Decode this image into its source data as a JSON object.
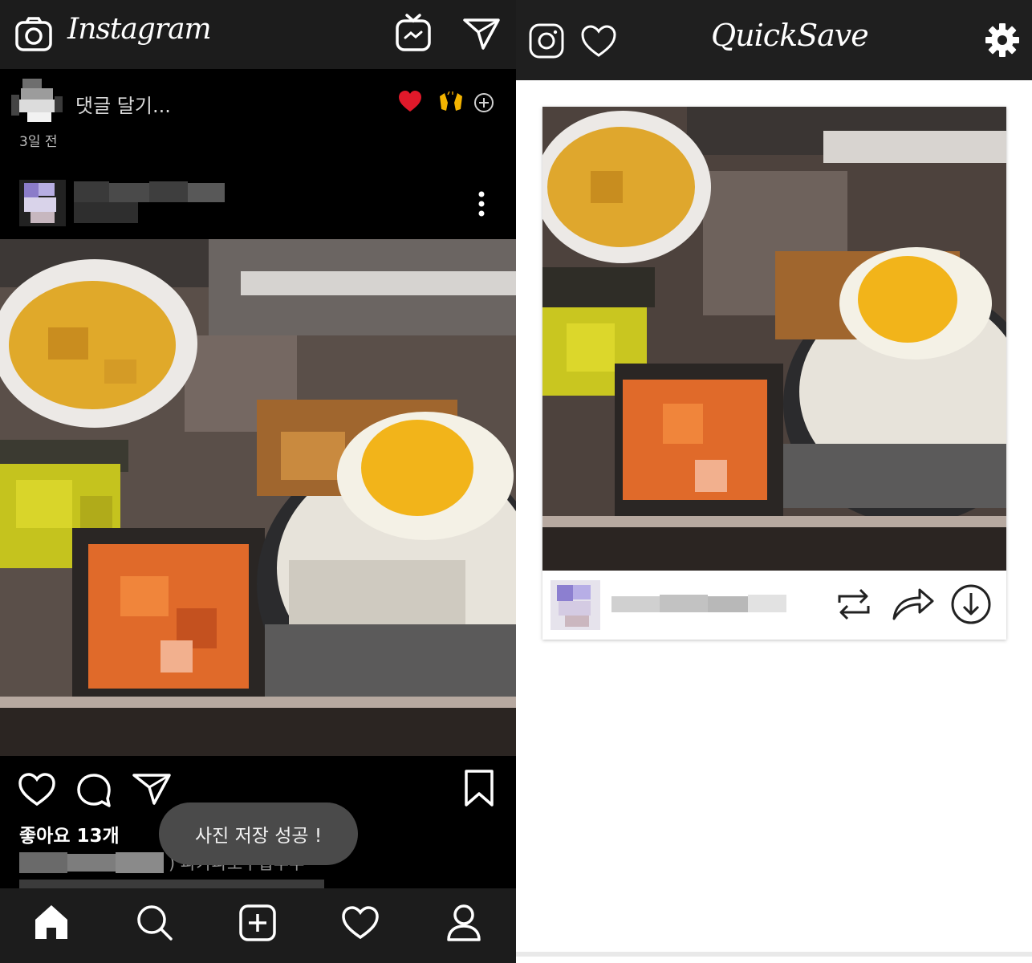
{
  "instagram": {
    "logo_text": "Instagram",
    "top_bar": {
      "icons": [
        "camera-icon",
        "igtv-icon",
        "direct-send-icon"
      ]
    },
    "comment_row": {
      "placeholder": "댓글 달기...",
      "time_ago": "3일 전",
      "quick_reactions": [
        "heart-emoji",
        "raised-hands-emoji"
      ],
      "more_icon": "plus-circle-icon"
    },
    "post_menu_icon": "more-vertical-icon",
    "actions": [
      "heart-icon",
      "comment-icon",
      "share-icon",
      "bookmark-icon"
    ],
    "likes_text": "좋아요 13개",
    "caption_visible": ") 파카파오무쌉추추",
    "toast_text": "사진 저장 성공 !",
    "bottom_nav": [
      "home-icon",
      "search-icon",
      "new-post-icon",
      "activity-icon",
      "profile-icon"
    ]
  },
  "quicksave": {
    "title": "QuickSave",
    "top_bar": {
      "icons": [
        "instagram-icon",
        "heart-icon",
        "settings-gear-icon"
      ]
    },
    "card_actions": [
      "repost-icon",
      "share-forward-icon",
      "download-icon"
    ]
  },
  "colors": {
    "ig_bar": "#1c1c1c",
    "ig_background": "#000000",
    "qs_bar": "#1f1f1f",
    "toast_bg": "#4a4a4a"
  }
}
